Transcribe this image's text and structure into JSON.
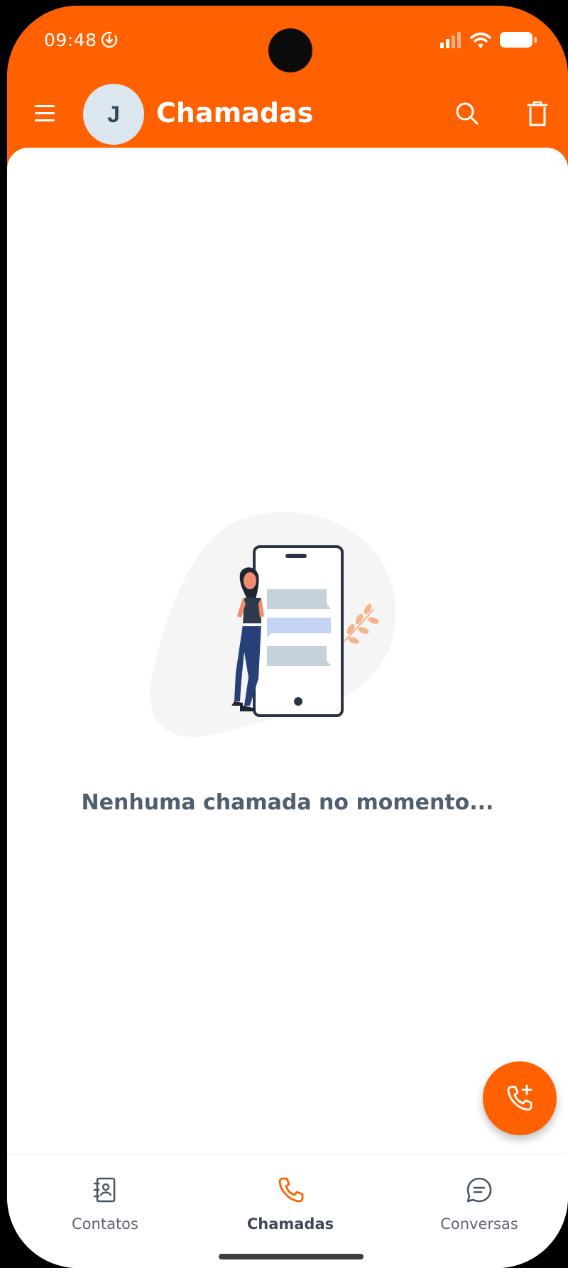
{
  "status_bar": {
    "time": "09:48",
    "download_icon": "download-circle-icon",
    "signal_icon": "signal-icon",
    "wifi_icon": "wifi-icon",
    "battery_icon": "battery-icon"
  },
  "app_bar": {
    "menu_icon": "menu-icon",
    "avatar_initial": "J",
    "title": "Chamadas",
    "search_icon": "search-icon",
    "trash_icon": "trash-icon"
  },
  "empty_state": {
    "message": "Nenhuma chamada no momento..."
  },
  "fab": {
    "icon": "phone-plus-icon"
  },
  "bottom_nav": {
    "items": [
      {
        "label": "Contatos",
        "icon": "contacts-book-icon",
        "active": false
      },
      {
        "label": "Chamadas",
        "icon": "phone-icon",
        "active": true
      },
      {
        "label": "Conversas",
        "icon": "chat-icon",
        "active": false
      }
    ]
  },
  "colors": {
    "brand": "#FF6000",
    "text_dark": "#505E70",
    "avatar_bg": "#DCE6EE"
  }
}
